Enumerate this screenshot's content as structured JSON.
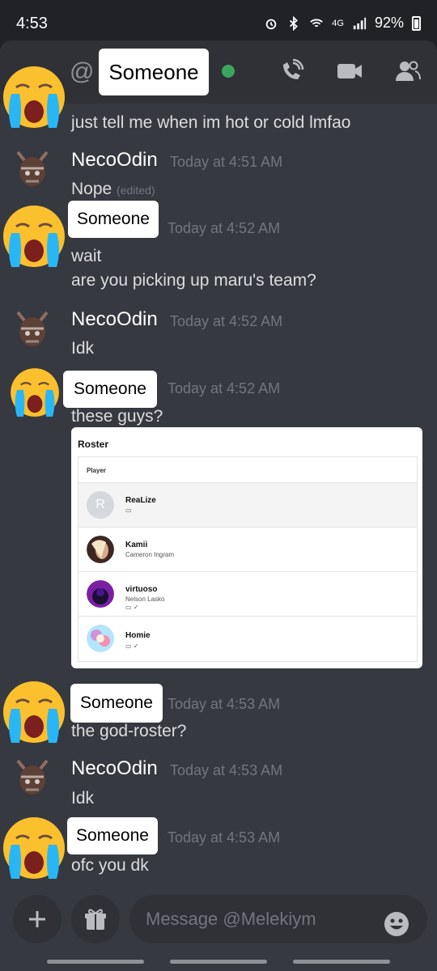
{
  "status_bar": {
    "time": "4:53",
    "network": "4G",
    "battery": "92%"
  },
  "header": {
    "at_symbol": "@",
    "contact_name": "Someone",
    "status_color": "#3ba55d",
    "icons": [
      "call-icon",
      "video-icon",
      "members-icon"
    ]
  },
  "messages": [
    {
      "author": "Someone",
      "timestamp": "",
      "lines": [
        "just tell me when im hot or cold lmfao"
      ]
    },
    {
      "author": "NecoOdin",
      "timestamp": "Today at 4:51 AM",
      "lines": [
        "Nope"
      ],
      "edited": "(edited)"
    },
    {
      "author": "Someone",
      "timestamp": "Today at 4:52 AM",
      "lines": [
        "wait",
        "are you picking up maru's team?"
      ]
    },
    {
      "author": "NecoOdin",
      "timestamp": "Today at 4:52 AM",
      "lines": [
        "Idk"
      ]
    },
    {
      "author": "Someone",
      "timestamp": "Today at 4:52 AM",
      "lines": [
        "these guys?"
      ]
    },
    {
      "author": "Someone",
      "timestamp": "Today at 4:53 AM",
      "lines": [
        "the god-roster?"
      ]
    },
    {
      "author": "NecoOdin",
      "timestamp": "Today at 4:53 AM",
      "lines": [
        "Idk"
      ]
    },
    {
      "author": "Someone",
      "timestamp": "Today at 4:53 AM",
      "lines": [
        "ofc you dk"
      ]
    }
  ],
  "roster_embed": {
    "title": "Roster",
    "column_header": "Player",
    "players": [
      {
        "name": "ReaLize",
        "initial": "R",
        "real_name": "",
        "social": "▭"
      },
      {
        "name": "Kamii",
        "initial": "",
        "real_name": "Cameron Ingram",
        "social": ""
      },
      {
        "name": "virtuoso",
        "initial": "",
        "real_name": "Nelson Lasko",
        "social": "▭ ✓"
      },
      {
        "name": "Homie",
        "initial": "",
        "real_name": "",
        "social": "▭ ✓"
      }
    ]
  },
  "input": {
    "placeholder": "Message @Melekiym"
  },
  "colors": {
    "background": "#36393f",
    "header": "#2f3136",
    "accent": "#3ba55d"
  }
}
